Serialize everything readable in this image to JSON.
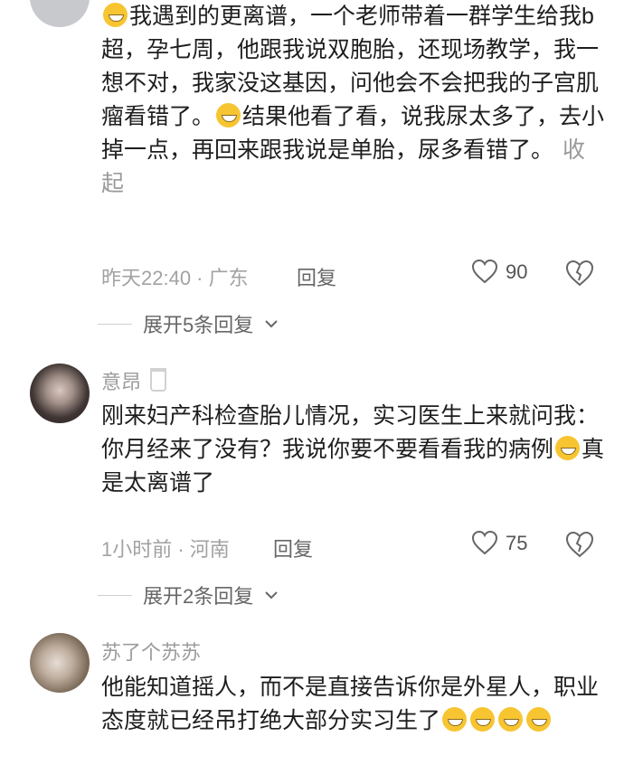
{
  "comment1": {
    "text1": "我遇到的更离谱，一个老师带着一群学生给我b超，孕七周，他跟我说双胞胎，还现场教学，我一想不对，我家没这基因，问他会不会把我的子宫肌瘤看错了。",
    "text2": "结果他看了看，说我尿太多了，去小掉一点，再回来跟我说是单胎，尿多看错了。",
    "collapse": "收起",
    "time_loc": "昨天22:40 · 广东",
    "reply": "回复",
    "likes": "90",
    "expand": "展开5条回复"
  },
  "comment2": {
    "username": "意昂",
    "text1": "刚来妇产科检查胎儿情况，实习医生上来就问我：你月经来了没有？我说你要不要看看我的病例",
    "text2": "真是太离谱了",
    "time_loc": "1小时前 · 河南",
    "reply": "回复",
    "likes": "75",
    "expand": "展开2条回复"
  },
  "comment3": {
    "username": "苏了个苏苏",
    "text": "他能知道摇人，而不是直接告诉你是外星人，职业态度就已经吊打绝大部分实习生了"
  }
}
